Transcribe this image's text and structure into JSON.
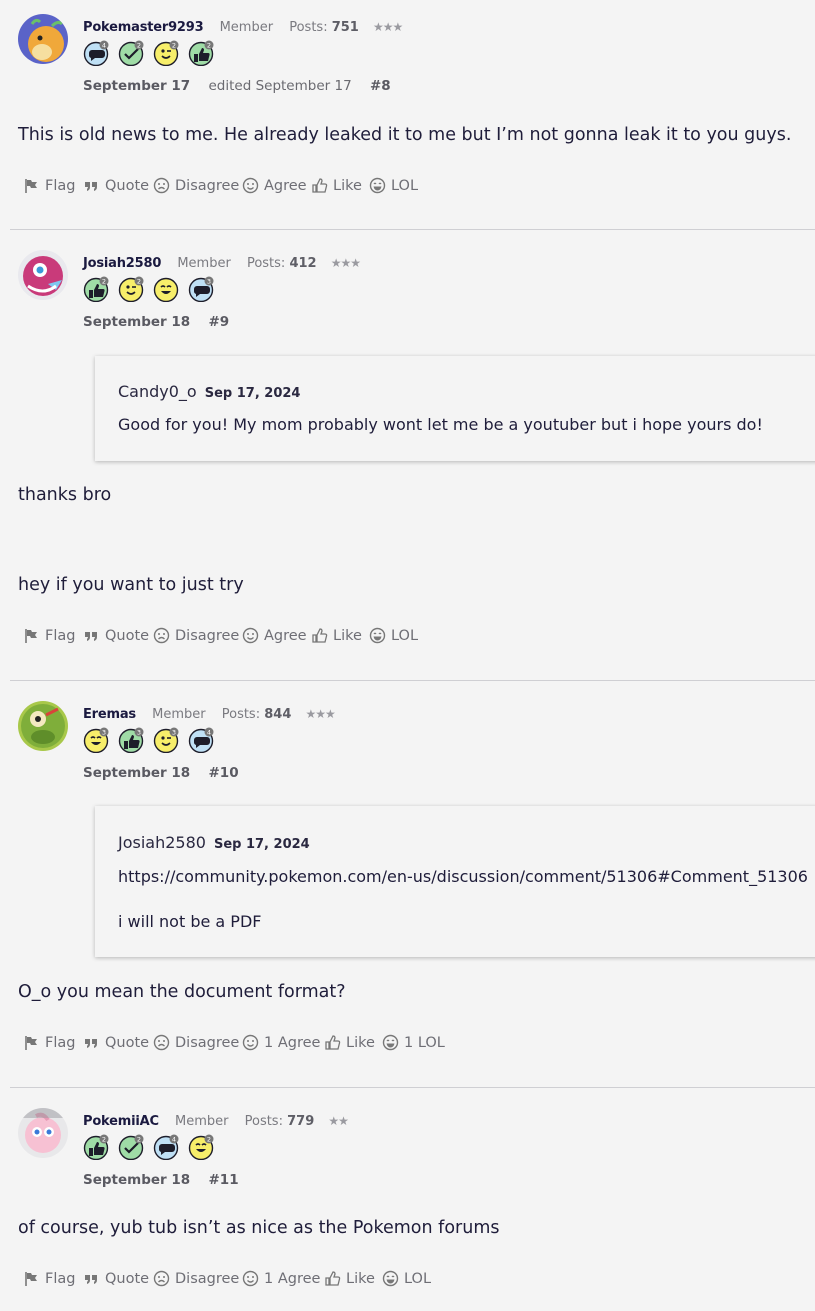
{
  "posts": [
    {
      "author": "Pokemaster9293",
      "role": "Member",
      "posts_label": "Posts:",
      "posts_count": "751",
      "stars": "★★★",
      "date": "September 17",
      "edited": "edited September 17",
      "number": "#8",
      "badges": [
        {
          "type": "comment",
          "count": "4"
        },
        {
          "type": "check",
          "count": "2"
        },
        {
          "type": "wink",
          "count": "2"
        },
        {
          "type": "thumb",
          "count": "2"
        }
      ],
      "body": [
        "This is old news to me. He already leaked it to me but I’m not gonna leak it to you guys."
      ],
      "reactions": {
        "flag": "Flag",
        "quote": "Quote",
        "disagree": "Disagree",
        "agree": "Agree",
        "like": "Like",
        "lol": "LOL"
      }
    },
    {
      "author": "Josiah2580",
      "role": "Member",
      "posts_label": "Posts:",
      "posts_count": "412",
      "stars": "★★★",
      "date": "September 18",
      "number": "#9",
      "badges": [
        {
          "type": "thumb",
          "count": "2"
        },
        {
          "type": "wink",
          "count": "2"
        },
        {
          "type": "grin",
          "count": ""
        },
        {
          "type": "comment",
          "count": "3"
        }
      ],
      "quote": {
        "author": "Candy0_o",
        "date": "Sep 17, 2024",
        "lines": [
          "Good for you! My mom probably wont let me be a youtuber but i hope yours do!"
        ]
      },
      "body": [
        "thanks bro",
        "hey if you want to just try"
      ],
      "reactions": {
        "flag": "Flag",
        "quote": "Quote",
        "disagree": "Disagree",
        "agree": "Agree",
        "like": "Like",
        "lol": "LOL"
      }
    },
    {
      "author": "Eremas",
      "role": "Member",
      "posts_label": "Posts:",
      "posts_count": "844",
      "stars": "★★★",
      "date": "September 18",
      "number": "#10",
      "badges": [
        {
          "type": "grin",
          "count": "3"
        },
        {
          "type": "thumb",
          "count": "3"
        },
        {
          "type": "wink",
          "count": "3"
        },
        {
          "type": "comment",
          "count": "4"
        }
      ],
      "quote": {
        "author": "Josiah2580",
        "date": "Sep 17, 2024",
        "lines": [
          "https://community.pokemon.com/en-us/discussion/comment/51306#Comment_51306",
          "i will not be a PDF"
        ]
      },
      "body": [
        "O_o you mean the document format?"
      ],
      "reactions": {
        "flag": "Flag",
        "quote": "Quote",
        "disagree": "Disagree",
        "agree": "1 Agree",
        "like": "Like",
        "lol": "1 LOL"
      }
    },
    {
      "author": "PokemiiAC",
      "role": "Member",
      "posts_label": "Posts:",
      "posts_count": "779",
      "stars": "★★",
      "date": "September 18",
      "number": "#11",
      "badges": [
        {
          "type": "thumb",
          "count": "2"
        },
        {
          "type": "check",
          "count": "2"
        },
        {
          "type": "comment",
          "count": "4"
        },
        {
          "type": "grin",
          "count": "2"
        }
      ],
      "body": [
        "of course, yub tub isn’t as nice as the Pokemon forums"
      ],
      "reactions": {
        "flag": "Flag",
        "quote": "Quote",
        "disagree": "Disagree",
        "agree": "1 Agree",
        "like": "Like",
        "lol": "LOL"
      }
    }
  ],
  "colors": {
    "background": "#f4f4f4",
    "author": "#1b1a40",
    "text": "#1f1d3a",
    "muted": "#6e6e75",
    "divider": "#cfcfd3",
    "badge_blue": "#bfe0f5",
    "badge_green": "#9fdca6",
    "badge_yellow": "#f7ee6a"
  }
}
